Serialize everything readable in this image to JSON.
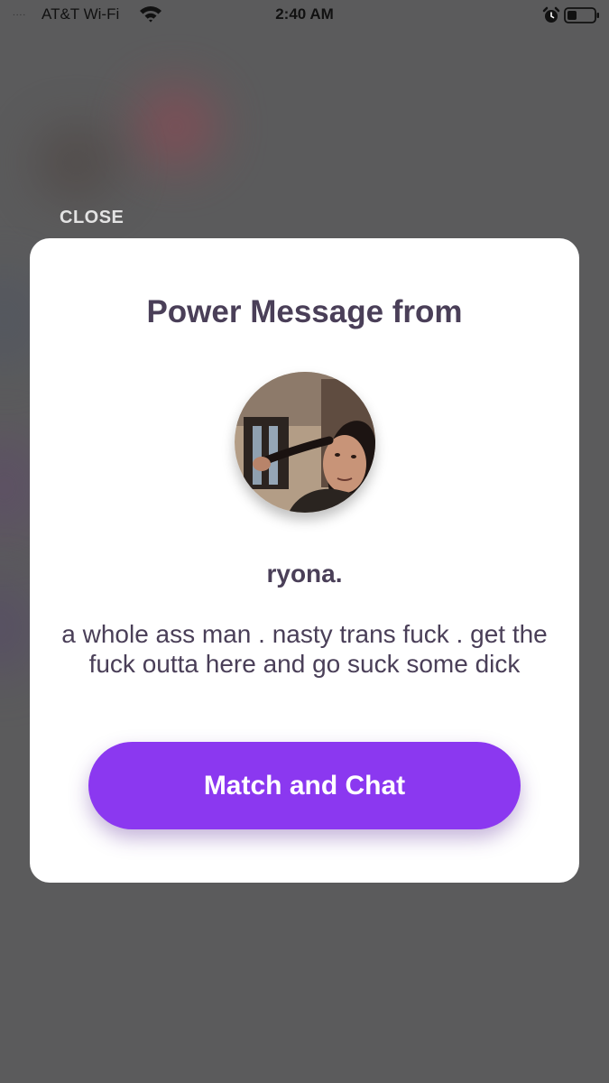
{
  "status_bar": {
    "signal": "....",
    "carrier": "AT&T Wi-Fi",
    "time": "2:40 AM"
  },
  "close_label": "CLOSE",
  "modal": {
    "title": "Power Message from",
    "username": "ryona.",
    "message": "a whole ass man . nasty trans fuck . get the fuck outta here and go suck some dick",
    "cta_label": "Match and Chat"
  },
  "icons": [
    "wifi-icon",
    "alarm-icon",
    "battery-icon"
  ],
  "colors": {
    "accent": "#8b38f0",
    "text": "#4a3f58",
    "overlay": "#5b5b5c"
  }
}
